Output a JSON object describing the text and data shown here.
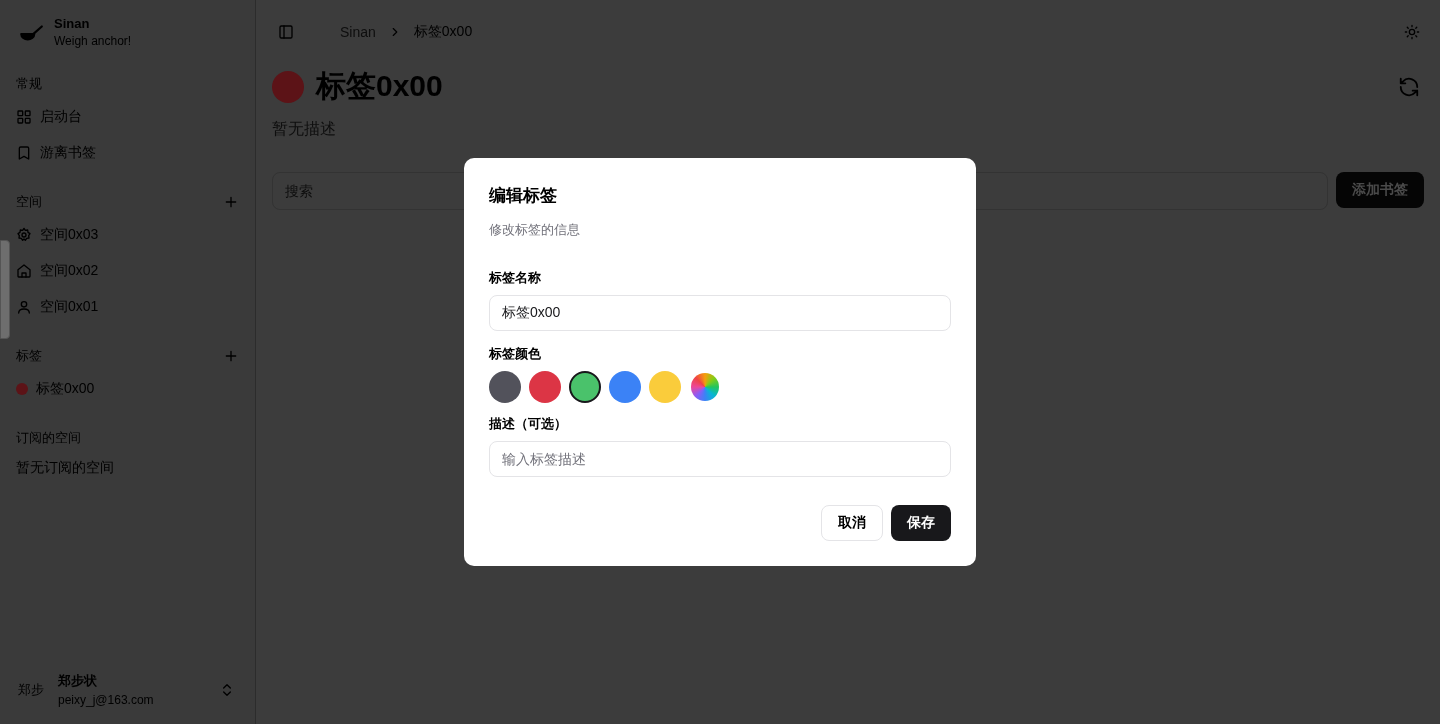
{
  "app": {
    "name": "Sinan",
    "tagline": "Weigh anchor!"
  },
  "sidebar": {
    "sections": [
      {
        "title": "常规",
        "add": false,
        "items": [
          {
            "label": "启动台",
            "kind": "grid"
          },
          {
            "label": "游离书签",
            "kind": "bookmark"
          }
        ]
      },
      {
        "title": "空间",
        "add": true,
        "items": [
          {
            "label": "空间0x03",
            "kind": "gear"
          },
          {
            "label": "空间0x02",
            "kind": "home"
          },
          {
            "label": "空间0x01",
            "kind": "user"
          }
        ]
      },
      {
        "title": "标签",
        "add": true,
        "items": [
          {
            "label": "标签0x00",
            "kind": "tag",
            "color": "#5c1317"
          }
        ]
      },
      {
        "title": "订阅的空间",
        "add": false,
        "empty_text": "暂无订阅的空间"
      }
    ]
  },
  "user": {
    "avatar": "郑步",
    "name": "郑步状",
    "email": "peixy_j@163.com"
  },
  "breadcrumb": [
    "Sinan",
    "标签0x00"
  ],
  "page": {
    "title": "标签0x00",
    "color": "#5c1317",
    "description": "暂无描述"
  },
  "search": {
    "placeholder": "搜索"
  },
  "add_bookmark": "添加书签",
  "dialog": {
    "title": "编辑标签",
    "subtitle": "修改标签的信息",
    "name_label": "标签名称",
    "name_value": "标签0x00",
    "color_label": "标签颜色",
    "swatches": [
      {
        "kind": "solid",
        "color": "#52525b",
        "selected": false
      },
      {
        "kind": "solid",
        "color": "#dc3545",
        "selected": false
      },
      {
        "kind": "solid",
        "color": "#4ac26b",
        "selected": true
      },
      {
        "kind": "solid",
        "color": "#3b82f6",
        "selected": false
      },
      {
        "kind": "solid",
        "color": "#facc3b",
        "selected": false
      },
      {
        "kind": "custom",
        "selected": false
      }
    ],
    "desc_label": "描述（可选）",
    "desc_placeholder": "输入标签描述",
    "cancel": "取消",
    "save": "保存"
  }
}
